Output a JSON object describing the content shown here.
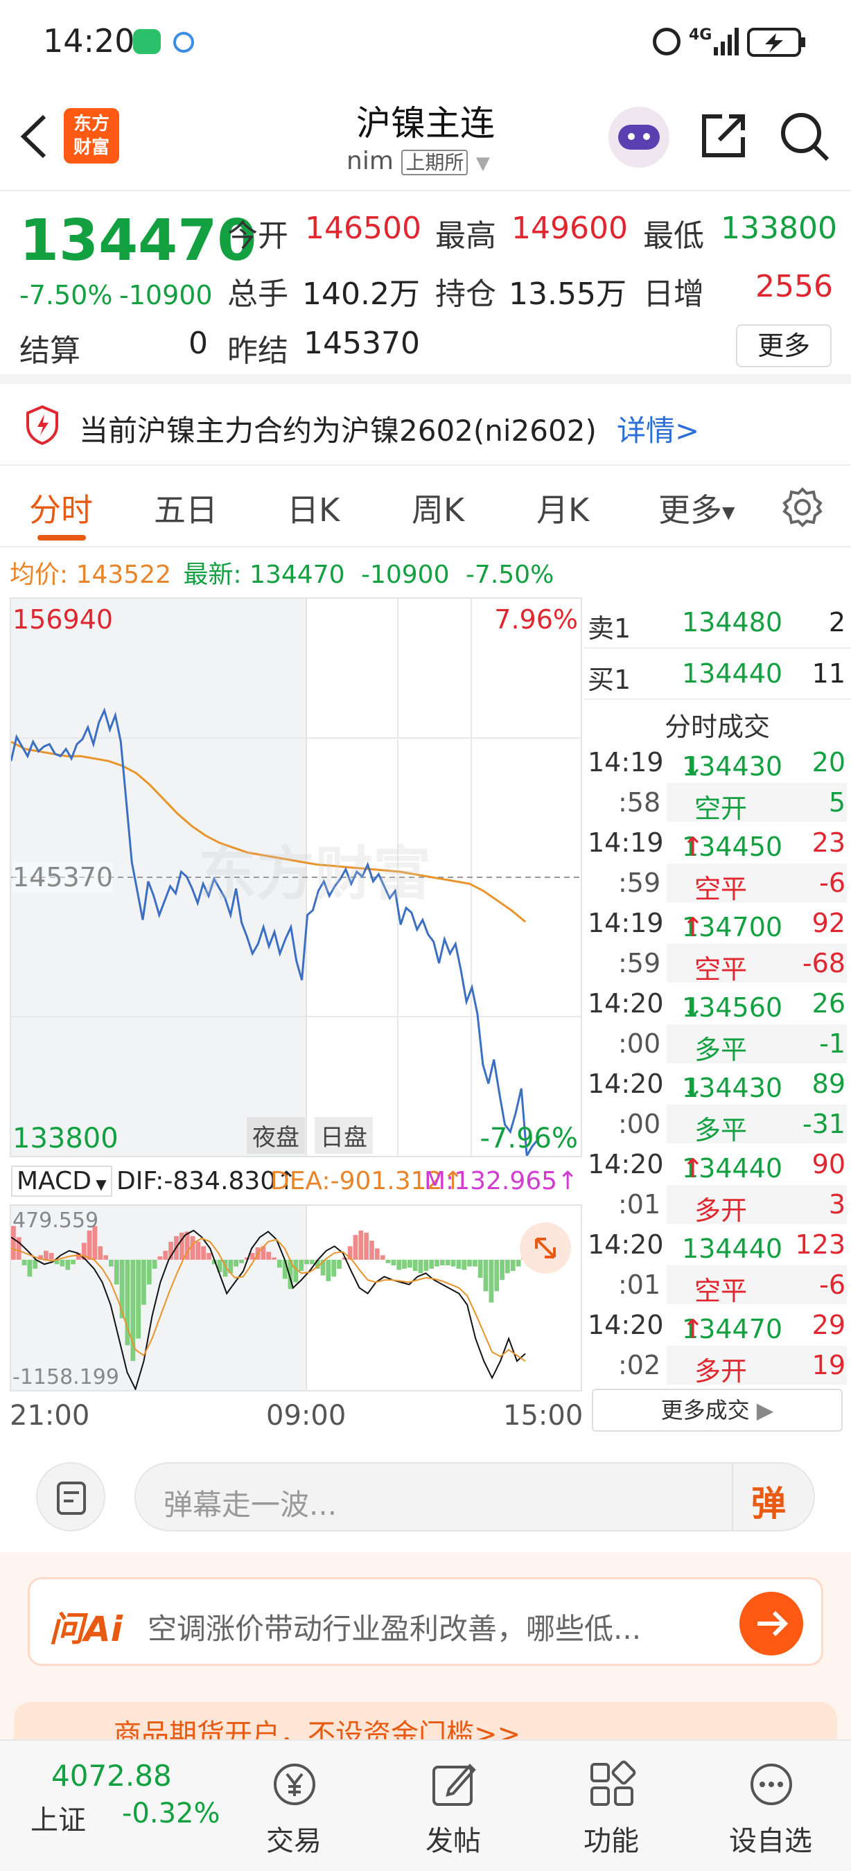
{
  "status": {
    "time": "14:20",
    "network": "4G"
  },
  "header": {
    "logo_line1": "东方",
    "logo_line2": "财富",
    "title": "沪镍主连",
    "code": "nim",
    "exchange": "上期所"
  },
  "quote": {
    "last": "134470",
    "change_pct": "-7.50%",
    "change_abs": "-10900",
    "settle_label": "结算",
    "settle_value": "0",
    "open_label": "今开",
    "open_value": "146500",
    "high_label": "最高",
    "high_value": "149600",
    "low_label": "最低",
    "low_value": "133800",
    "volume_label": "总手",
    "volume_value": "140.2万",
    "oi_label": "持仓",
    "oi_value": "13.55万",
    "daily_inc_label": "日增",
    "daily_inc_value": "2556",
    "prev_settle_label": "昨结",
    "prev_settle_value": "145370",
    "more_label": "更多"
  },
  "notice": {
    "text": "当前沪镍主力合约为沪镍2602(ni2602)",
    "link": "详情>"
  },
  "tabs": [
    "分时",
    "五日",
    "日K",
    "周K",
    "月K",
    "更多"
  ],
  "chart_info": {
    "avg_label": "均价:",
    "avg_value": "143522",
    "latest_label": "最新:",
    "latest_value": "134470",
    "latest_change": "-10900",
    "latest_pct": "-7.50%"
  },
  "chart_data": {
    "type": "line",
    "y_high": "156940",
    "y_high_pct": "7.96%",
    "y_mid": "145370",
    "y_low": "133800",
    "y_low_pct": "-7.96%",
    "ylim": [
      133800,
      156940
    ],
    "x_ticks": [
      "21:00",
      "09:00",
      "15:00"
    ],
    "session_labels": [
      "夜盘",
      "日盘"
    ],
    "watermark": "东方财富",
    "price": [
      150200,
      151200,
      150800,
      150400,
      151000,
      150600,
      150800,
      150900,
      150500,
      150400,
      150700,
      150300,
      150900,
      151100,
      151600,
      150900,
      151800,
      152300,
      151500,
      152100,
      151000,
      148500,
      146000,
      144800,
      143600,
      145200,
      144600,
      143800,
      144400,
      145000,
      144700,
      145600,
      145400,
      144900,
      144300,
      145100,
      144600,
      145300,
      144900,
      144500,
      143800,
      144900,
      143500,
      142900,
      142200,
      142600,
      143300,
      142500,
      143100,
      142200,
      142800,
      143300,
      141900,
      141100,
      143800,
      144000,
      144800,
      145200,
      144600,
      145000,
      145300,
      145700,
      145100,
      145600,
      145400,
      145900,
      145200,
      145500,
      145000,
      144500,
      144800,
      143400,
      144100,
      143900,
      143200,
      143600,
      143000,
      142700,
      141800,
      142800,
      142200,
      142600,
      141500,
      140200,
      140800,
      139700,
      137600,
      136800,
      137800,
      136400,
      135100,
      134800,
      135600,
      136600,
      133800,
      134200,
      134470
    ],
    "avg": [
      151000,
      150700,
      150600,
      150500,
      150400,
      150400,
      150300,
      150200,
      150000,
      149700,
      149200,
      148600,
      148000,
      147500,
      147100,
      146800,
      146600,
      146400,
      146300,
      146200,
      146100,
      146000,
      145900,
      145850,
      145800,
      145750,
      145700,
      145650,
      145600,
      145500,
      145400,
      145300,
      145200,
      145100,
      144800,
      144400,
      144000,
      143522
    ],
    "macd_label": "MACD",
    "dif": "DIF:-834.830",
    "dea": "DEA:-901.312",
    "m": "M:132.965",
    "macd_top": "479.559",
    "macd_bottom": "-1158.199",
    "macd_ylim": [
      -1158.199,
      479.559
    ],
    "macd_hist": [
      300,
      200,
      -50,
      -150,
      -80,
      40,
      80,
      60,
      -40,
      -60,
      -90,
      -40,
      60,
      150,
      260,
      300,
      120,
      40,
      -60,
      -220,
      -520,
      -760,
      -900,
      -700,
      -400,
      -220,
      -80,
      30,
      80,
      160,
      210,
      240,
      250,
      210,
      160,
      120,
      60,
      -40,
      -110,
      -150,
      -120,
      -60,
      -30,
      20,
      60,
      110,
      120,
      70,
      20,
      -70,
      -170,
      -260,
      -200,
      -100,
      -40,
      -40,
      -80,
      -140,
      -190,
      -150,
      -80,
      20,
      120,
      220,
      260,
      240,
      170,
      100,
      40,
      -30,
      -50,
      -90,
      -80,
      -70,
      -100,
      -120,
      -100,
      -80,
      -60,
      -50,
      -50,
      -60,
      -80,
      -90,
      -60,
      -60,
      -160,
      -280,
      -380,
      -280,
      -180,
      -120,
      -100,
      -60,
      20,
      150,
      260
    ],
    "dif_series": [
      200,
      150,
      80,
      0,
      -40,
      -20,
      40,
      80,
      60,
      0,
      -80,
      -200,
      -400,
      -700,
      -1000,
      -1150,
      -900,
      -500,
      -200,
      0,
      120,
      220,
      260,
      200,
      100,
      -100,
      -300,
      -200,
      -100,
      100,
      200,
      250,
      180,
      0,
      -250,
      -180,
      -100,
      0,
      80,
      120,
      60,
      -100,
      -250,
      -300,
      -200,
      -150,
      -180,
      -200,
      -220,
      -150,
      -120,
      -180,
      -220,
      -260,
      -300,
      -400,
      -700,
      -900,
      -1050,
      -900,
      -700,
      -900,
      -834.83
    ],
    "dea_series": [
      100,
      80,
      50,
      20,
      0,
      -10,
      10,
      30,
      40,
      30,
      0,
      -80,
      -200,
      -380,
      -600,
      -800,
      -850,
      -700,
      -500,
      -300,
      -120,
      40,
      150,
      190,
      160,
      60,
      -80,
      -160,
      -150,
      -40,
      80,
      160,
      180,
      100,
      -60,
      -120,
      -110,
      -60,
      10,
      60,
      70,
      10,
      -90,
      -180,
      -200,
      -180,
      -180,
      -190,
      -200,
      -180,
      -160,
      -170,
      -190,
      -220,
      -250,
      -320,
      -480,
      -650,
      -820,
      -860,
      -800,
      -850,
      -901.312
    ]
  },
  "order_book": {
    "sell_label": "卖1",
    "sell_price": "134480",
    "sell_vol": "2",
    "buy_label": "买1",
    "buy_price": "134440",
    "buy_vol": "11",
    "trades_title": "分时成交",
    "trades": [
      {
        "t1": "14:19",
        "p": "134430",
        "d": "↓",
        "v": "20",
        "t2": ":58",
        "kind": "空开",
        "n": "5",
        "pc": "green",
        "kc": "green",
        "vc": "green"
      },
      {
        "t1": "14:19",
        "p": "134450",
        "d": "↑",
        "v": "23",
        "t2": ":59",
        "kind": "空平",
        "n": "-6",
        "pc": "green",
        "kc": "red",
        "vc": "red"
      },
      {
        "t1": "14:19",
        "p": "134700",
        "d": "↑",
        "v": "92",
        "t2": ":59",
        "kind": "空平",
        "n": "-68",
        "pc": "green",
        "kc": "red",
        "vc": "red"
      },
      {
        "t1": "14:20",
        "p": "134560",
        "d": "↓",
        "v": "26",
        "t2": ":00",
        "kind": "多平",
        "n": "-1",
        "pc": "green",
        "kc": "green",
        "vc": "green"
      },
      {
        "t1": "14:20",
        "p": "134430",
        "d": "↓",
        "v": "89",
        "t2": ":00",
        "kind": "多平",
        "n": "-31",
        "pc": "green",
        "kc": "green",
        "vc": "green"
      },
      {
        "t1": "14:20",
        "p": "134440",
        "d": "↑",
        "v": "90",
        "t2": ":01",
        "kind": "多开",
        "n": "3",
        "pc": "green",
        "kc": "red",
        "vc": "red"
      },
      {
        "t1": "14:20",
        "p": "134440",
        "d": "",
        "v": "123",
        "t2": ":01",
        "kind": "空平",
        "n": "-6",
        "pc": "green",
        "kc": "red",
        "vc": "red"
      },
      {
        "t1": "14:20",
        "p": "134470",
        "d": "↑",
        "v": "29",
        "t2": ":02",
        "kind": "多开",
        "n": "19",
        "pc": "green",
        "kc": "red",
        "vc": "red"
      }
    ],
    "more_trades": "更多成交"
  },
  "danmu": {
    "placeholder": "弹幕走一波...",
    "button": "弹"
  },
  "ai": {
    "logo": "问Ai",
    "text": "空调涨价带动行业盈利改善，哪些低...",
    "promo": "商品期货开户，不设资金门槛>>"
  },
  "nav": {
    "index_value": "4072.88",
    "index_name": "上证",
    "index_change": "-0.32%",
    "items": [
      "交易",
      "发帖",
      "功能",
      "设自选"
    ]
  }
}
